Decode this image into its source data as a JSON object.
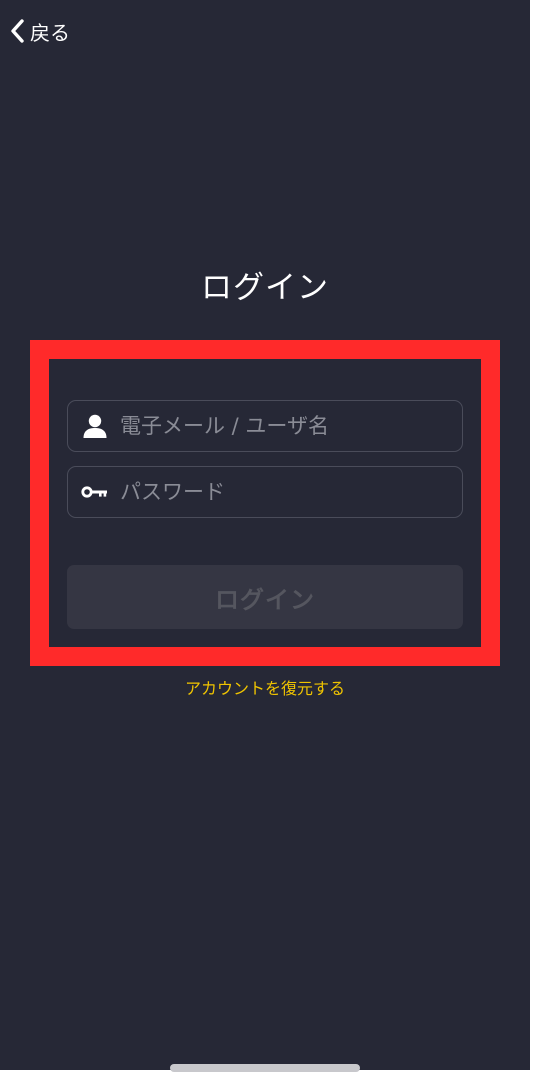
{
  "header": {
    "back_label": "戻る"
  },
  "login": {
    "title": "ログイン",
    "username_placeholder": "電子メール / ユーザ名",
    "password_placeholder": "パスワード",
    "submit_label": "ログイン",
    "restore_link": "アカウントを復元する"
  },
  "icons": {
    "back": "chevron-left-icon",
    "username": "user-icon",
    "password": "key-icon"
  },
  "colors": {
    "background": "#262836",
    "highlight_frame": "#ff2a2a",
    "link": "#f0c400",
    "button_disabled": "#353643"
  }
}
